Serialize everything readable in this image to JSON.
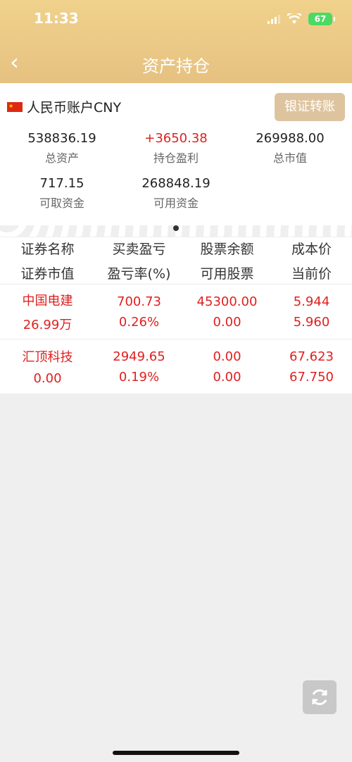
{
  "status": {
    "time": "11:33",
    "battery": "67"
  },
  "header": {
    "title": "资产持仓"
  },
  "account": {
    "label": "人民币账户CNY",
    "transfer": "银证转账"
  },
  "metrics": [
    {
      "value": "538836.19",
      "label": "总资产"
    },
    {
      "value": "+3650.38",
      "label": "持仓盈利"
    },
    {
      "value": "269988.00",
      "label": "总市值"
    },
    {
      "value": "717.15",
      "label": "可取资金"
    },
    {
      "value": "268848.19",
      "label": "可用资金"
    }
  ],
  "table": {
    "headers": [
      [
        "证券名称",
        "证券市值"
      ],
      [
        "买卖盈亏",
        "盈亏率(%)"
      ],
      [
        "股票余额",
        "可用股票"
      ],
      [
        "成本价",
        "当前价"
      ]
    ],
    "rows": [
      [
        [
          "中国电建",
          "26.99万"
        ],
        [
          "700.73",
          "0.26%"
        ],
        [
          "45300.00",
          "0.00"
        ],
        [
          "5.944",
          "5.960"
        ]
      ],
      [
        [
          "汇顶科技",
          "0.00"
        ],
        [
          "2949.65",
          "0.19%"
        ],
        [
          "0.00",
          "0.00"
        ],
        [
          "67.623",
          "67.750"
        ]
      ]
    ]
  },
  "colors": {
    "accent": "#e6c181",
    "profit": "#e02020"
  }
}
